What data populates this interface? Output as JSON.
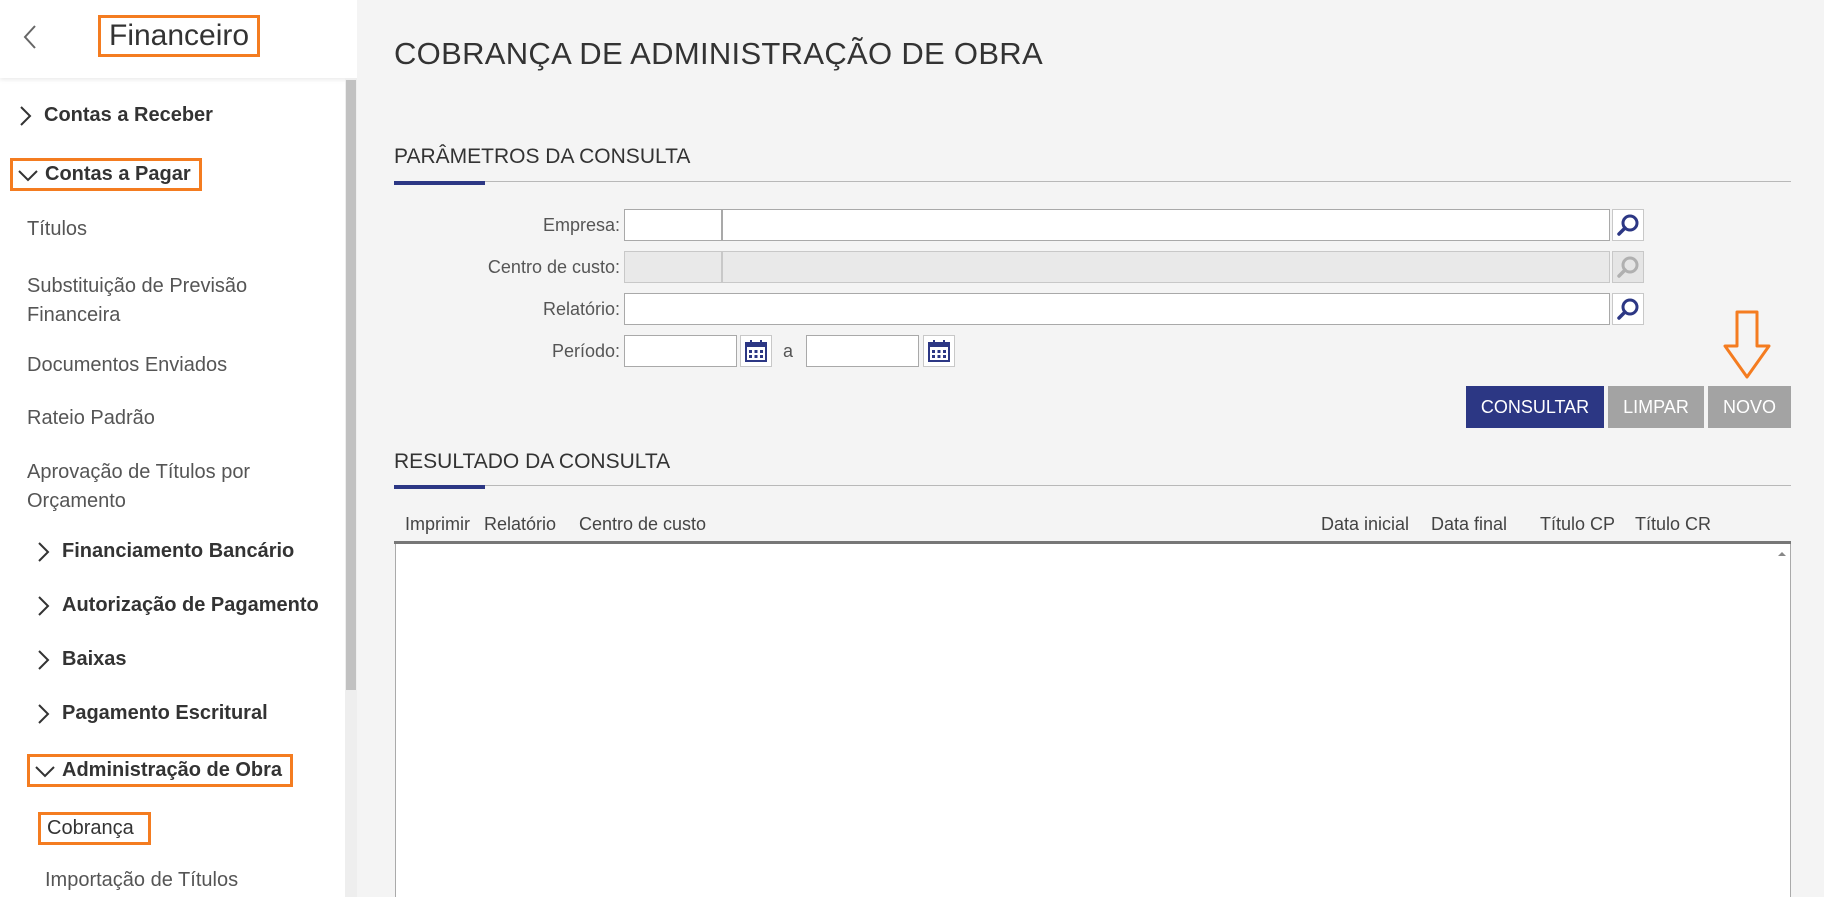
{
  "sidebar": {
    "title": "Financeiro",
    "items": [
      {
        "label": "Contas a Receber"
      },
      {
        "label": "Contas a Pagar"
      },
      {
        "label": "Títulos"
      },
      {
        "label": "Substituição de Previsão"
      },
      {
        "label": "Financeira"
      },
      {
        "label": "Documentos Enviados"
      },
      {
        "label": "Rateio Padrão"
      },
      {
        "label": "Aprovação de Títulos por"
      },
      {
        "label": "Orçamento"
      },
      {
        "label": "Financiamento Bancário"
      },
      {
        "label": "Autorização de Pagamento"
      },
      {
        "label": "Baixas"
      },
      {
        "label": "Pagamento Escritural"
      },
      {
        "label": "Administração de Obra"
      },
      {
        "label": "Cobrança"
      },
      {
        "label": "Importação de Títulos"
      }
    ]
  },
  "page": {
    "title": "COBRANÇA DE ADMINISTRAÇÃO DE OBRA"
  },
  "params": {
    "section_title": "PARÂMETROS DA CONSULTA",
    "empresa_label": "Empresa:",
    "centro_label": "Centro de custo:",
    "relatorio_label": "Relatório:",
    "periodo_label": "Período:",
    "periodo_sep": "a"
  },
  "buttons": {
    "consultar": "CONSULTAR",
    "limpar": "LIMPAR",
    "novo": "NOVO"
  },
  "results": {
    "section_title": "RESULTADO DA CONSULTA",
    "columns": [
      "Imprimir",
      "Relatório",
      "Centro de custo",
      "Data inicial",
      "Data final",
      "Título CP",
      "Título CR"
    ]
  },
  "colors": {
    "accent": "#2c3784",
    "highlight": "#f47c20",
    "button_disabled": "#a3a3a3"
  }
}
